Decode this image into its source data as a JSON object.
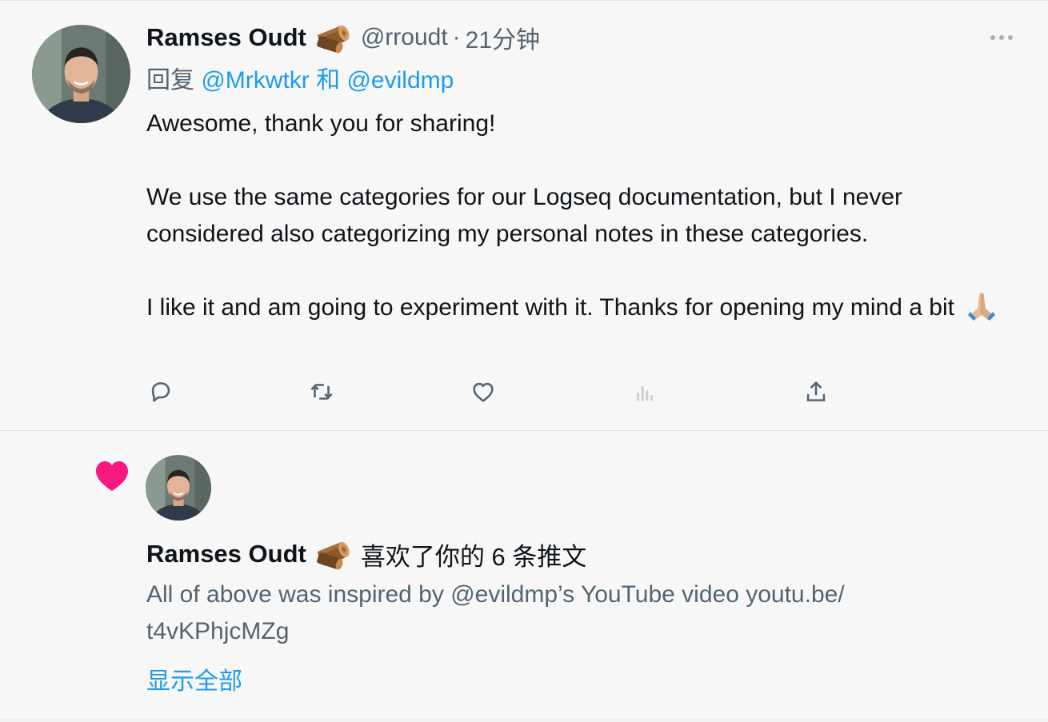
{
  "tweet": {
    "author_name": "Ramses Oudt",
    "author_emoji": "wood-log-emoji",
    "handle": "@rroudt",
    "separator": "·",
    "time": "21分钟",
    "reply_prefix": "回复",
    "reply_to_1": "@Mrkwtkr",
    "reply_joiner": "和",
    "reply_to_2": "@evildmp",
    "text_line_1": "Awesome, thank you for sharing!",
    "text_para_2": "We use the same categories for our Logseq documentation, but I never considered also categorizing my personal notes in these categories.",
    "text_para_3": "I like it and am going to experiment with it. Thanks for opening my mind a bit",
    "text_emoji": "folded-hands-emoji",
    "actions": [
      "reply-icon",
      "retweet-icon",
      "like-icon",
      "analytics-icon",
      "share-icon"
    ]
  },
  "notification": {
    "icon": "heart-icon",
    "author_name": "Ramses Oudt",
    "description": "喜欢了你的 6 条推文",
    "preview_text": "All of above was inspired by @evildmp’s YouTube video youtu.be/\nt4vKPhjcMZg",
    "show_all_label": "显示全部"
  },
  "colors": {
    "link": "#1d9bf0",
    "secondary_text": "#536471",
    "heart": "#f91880",
    "background": "#f7f7f7"
  }
}
